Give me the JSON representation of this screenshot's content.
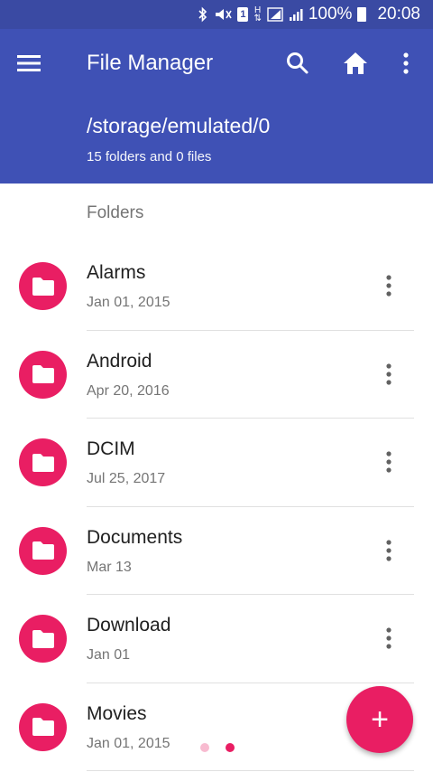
{
  "status_bar": {
    "battery_percent": "100%",
    "time": "20:08",
    "network_label": "H",
    "sim_label": "1"
  },
  "app_bar": {
    "title": "File Manager",
    "path": "/storage/emulated/0",
    "summary": "15 folders and 0 files"
  },
  "section_label": "Folders",
  "folders": [
    {
      "name": "Alarms",
      "date": "Jan 01, 2015"
    },
    {
      "name": "Android",
      "date": "Apr 20, 2016"
    },
    {
      "name": "DCIM",
      "date": "Jul 25, 2017"
    },
    {
      "name": "Documents",
      "date": "Mar 13"
    },
    {
      "name": "Download",
      "date": "Jan 01"
    },
    {
      "name": "Movies",
      "date": "Jan 01, 2015"
    }
  ],
  "fab_label": "+",
  "pager": {
    "page_count": 2,
    "active_index": 1
  },
  "colors": {
    "primary": "#3f51b5",
    "primary_dark": "#3a4aa3",
    "accent": "#e91e63",
    "dot_inactive": "#f8bbd0",
    "dot_active": "#e91e63"
  },
  "icons": {
    "menu": "menu-icon",
    "search": "search-icon",
    "home": "home-icon",
    "more": "more-vert-icon",
    "folder": "folder-icon",
    "add": "add-icon"
  }
}
